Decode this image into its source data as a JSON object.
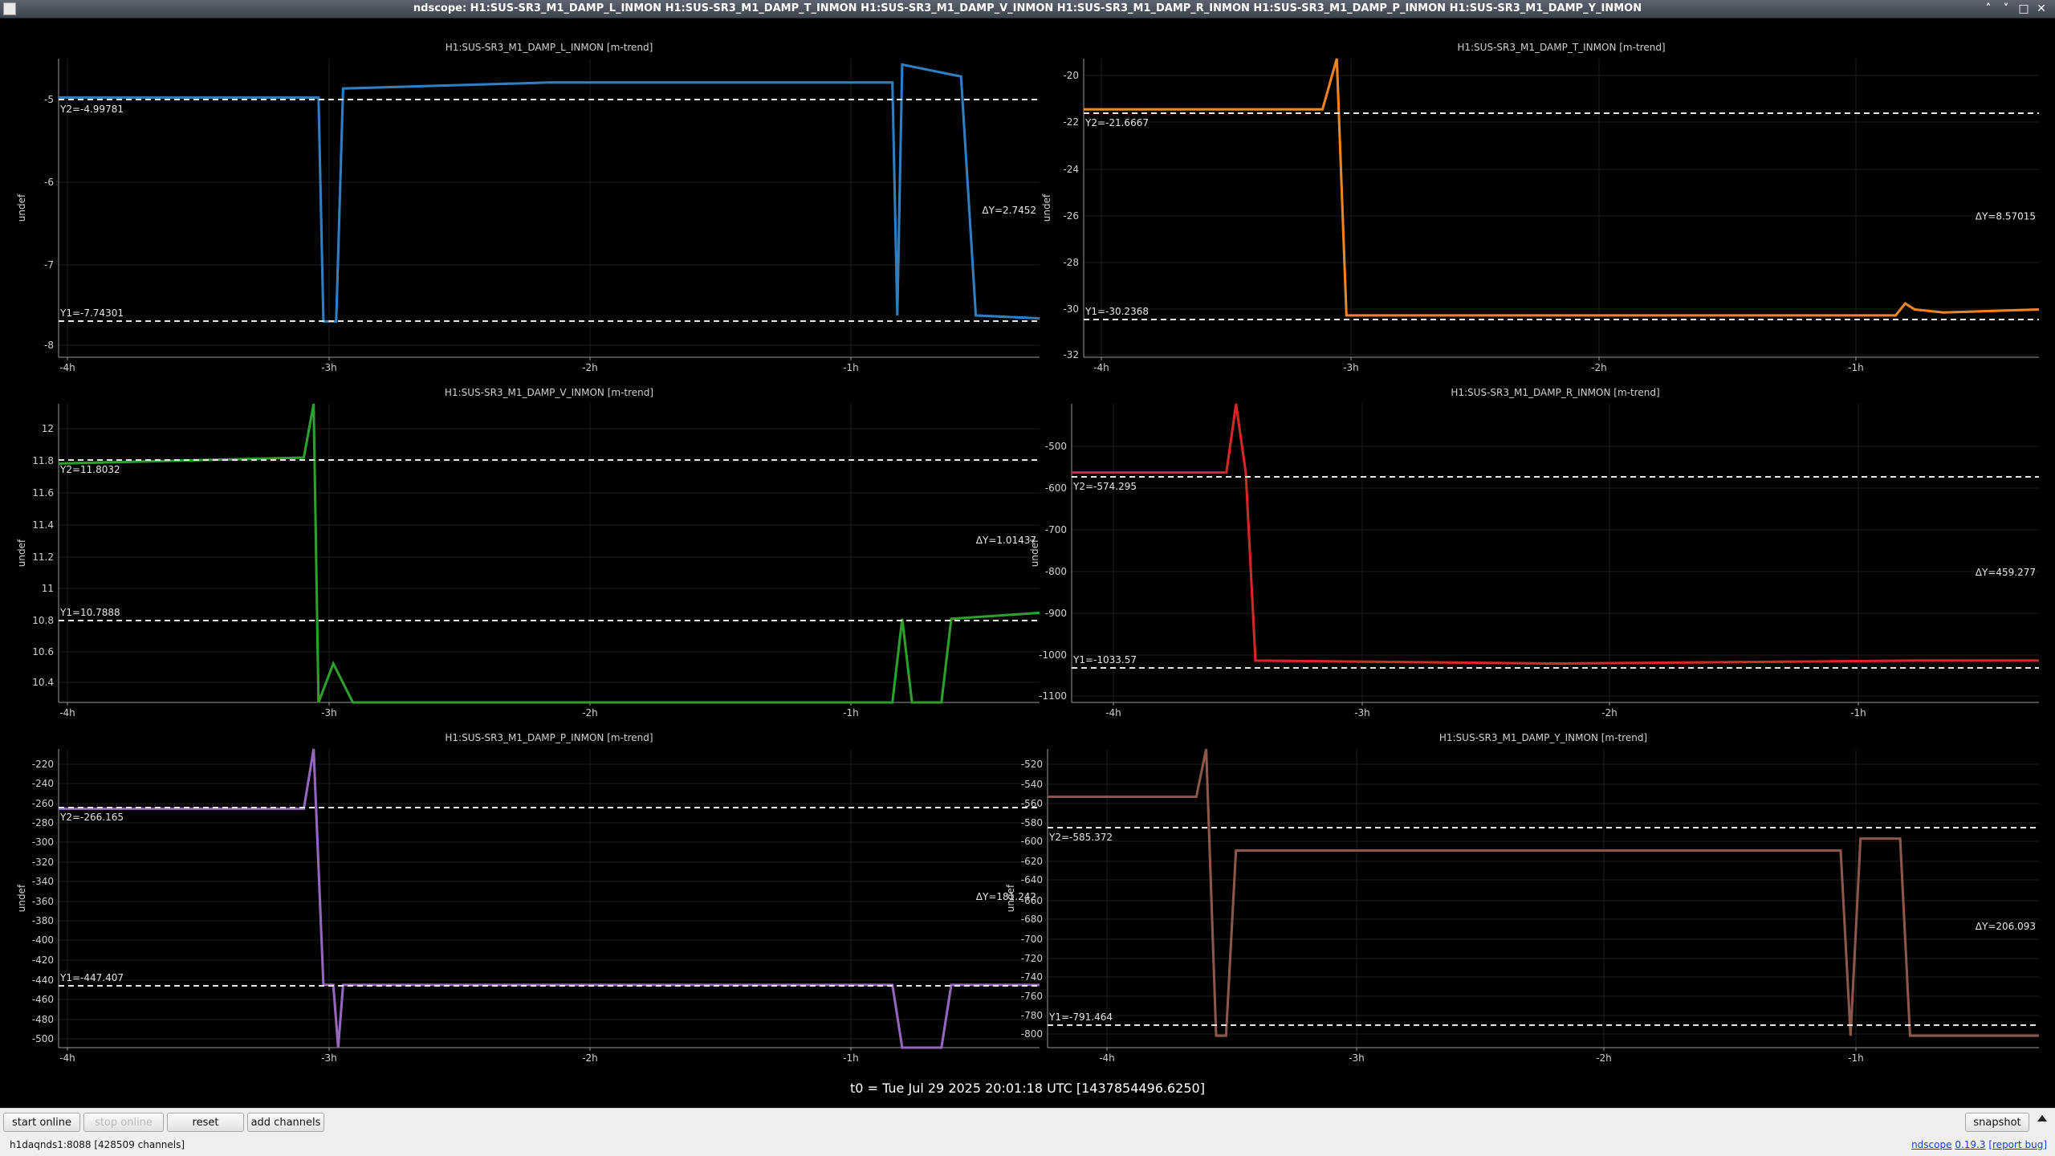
{
  "window": {
    "title": "ndscope: H1:SUS-SR3_M1_DAMP_L_INMON H1:SUS-SR3_M1_DAMP_T_INMON H1:SUS-SR3_M1_DAMP_V_INMON H1:SUS-SR3_M1_DAMP_R_INMON H1:SUS-SR3_M1_DAMP_P_INMON H1:SUS-SR3_M1_DAMP_Y_INMON",
    "controls": [
      "˄",
      "˅",
      "□",
      "✕"
    ]
  },
  "x_ticks": [
    "-4h",
    "-3h",
    "-2h",
    "-1h"
  ],
  "ylabel": "undef",
  "plots": [
    {
      "title": "H1:SUS-SR3_M1_DAMP_L_INMON [m-trend]",
      "color": "#2d7fc2",
      "yticks": [
        "-5",
        "-6",
        "-7",
        "-8"
      ],
      "y2": "Y2=-4.99781",
      "y1": "Y1=-7.74301",
      "dy": "ΔY=2.7452"
    },
    {
      "title": "H1:SUS-SR3_M1_DAMP_T_INMON [m-trend]",
      "color": "#ef8321",
      "yticks": [
        "-20",
        "-22",
        "-24",
        "-26",
        "-28",
        "-30",
        "-32"
      ],
      "y2": "Y2=-21.6667",
      "y1": "Y1=-30.2368",
      "dy": "ΔY=8.57015"
    },
    {
      "title": "H1:SUS-SR3_M1_DAMP_V_INMON [m-trend]",
      "color": "#2ca02c",
      "yticks": [
        "12",
        "11.8",
        "11.6",
        "11.4",
        "11.2",
        "11",
        "10.8",
        "10.6",
        "10.4"
      ],
      "y2": "Y2=11.8032",
      "y1": "Y1=10.7888",
      "dy": "ΔY=1.01437"
    },
    {
      "title": "H1:SUS-SR3_M1_DAMP_R_INMON [m-trend]",
      "color": "#d62728",
      "yticks": [
        "-500",
        "-600",
        "-700",
        "-800",
        "-900",
        "-1000",
        "-1100"
      ],
      "y2": "Y2=-574.295",
      "y1": "Y1=-1033.57",
      "dy": "ΔY=459.277"
    },
    {
      "title": "H1:SUS-SR3_M1_DAMP_P_INMON [m-trend]",
      "color": "#9467bd",
      "yticks": [
        "-220",
        "-240",
        "-260",
        "-280",
        "-300",
        "-320",
        "-340",
        "-360",
        "-380",
        "-400",
        "-420",
        "-440",
        "-460",
        "-480",
        "-500"
      ],
      "y2": "Y2=-266.165",
      "y1": "Y1=-447.407",
      "dy": "ΔY=181.242"
    },
    {
      "title": "H1:SUS-SR3_M1_DAMP_Y_INMON [m-trend]",
      "color": "#8c564b",
      "yticks": [
        "-520",
        "-540",
        "-560",
        "-580",
        "-600",
        "-620",
        "-640",
        "-660",
        "-680",
        "-700",
        "-720",
        "-740",
        "-760",
        "-780",
        "-800"
      ],
      "y2": "Y2=-585.372",
      "y1": "Y1=-791.464",
      "dy": "ΔY=206.093"
    }
  ],
  "t0": "t0 = Tue Jul 29 2025 20:01:18 UTC [1437854496.6250]",
  "toolbar": {
    "start_online": "start online",
    "stop_online": "stop online",
    "reset": "reset",
    "add_channels": "add channels",
    "snapshot": "snapshot"
  },
  "status": {
    "server": "h1daqnds1:8088  [428509 channels]",
    "app": "ndscope",
    "version": "0.19.3",
    "report": "[report bug]"
  }
}
